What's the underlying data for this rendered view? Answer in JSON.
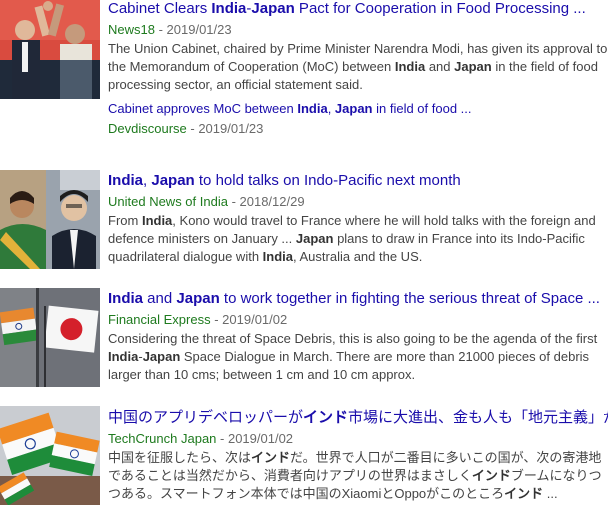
{
  "results": [
    {
      "title_parts": [
        {
          "t": "Cabinet Clears ",
          "b": false
        },
        {
          "t": "India",
          "b": true
        },
        {
          "t": "-",
          "b": false
        },
        {
          "t": "Japan",
          "b": true
        },
        {
          "t": " Pact for Cooperation in Food Processing ...",
          "b": false
        }
      ],
      "source": "News18",
      "date": "2019/01/23",
      "snippet_parts": [
        {
          "t": "The Union Cabinet, chaired by Prime Minister Narendra Modi, has given its approval to the Memorandum of Cooperation (MoC) between ",
          "b": false
        },
        {
          "t": "India",
          "b": true
        },
        {
          "t": " and ",
          "b": false
        },
        {
          "t": "Japan",
          "b": true
        },
        {
          "t": " in the field of food processing sector, an official statement said.",
          "b": false
        }
      ],
      "related": {
        "title_parts": [
          {
            "t": "Cabinet approves MoC between ",
            "b": false
          },
          {
            "t": "India",
            "b": true
          },
          {
            "t": ", ",
            "b": false
          },
          {
            "t": "Japan",
            "b": true
          },
          {
            "t": " in field of food ...",
            "b": false
          }
        ],
        "source": "Devdiscourse",
        "date": "2019/01/23"
      }
    },
    {
      "title_parts": [
        {
          "t": "India",
          "b": true
        },
        {
          "t": ", ",
          "b": false
        },
        {
          "t": "Japan",
          "b": true
        },
        {
          "t": " to hold talks on Indo-Pacific next month",
          "b": false
        }
      ],
      "source": "United News of India",
      "date": "2018/12/29",
      "snippet_parts": [
        {
          "t": "From ",
          "b": false
        },
        {
          "t": "India",
          "b": true
        },
        {
          "t": ", Kono would travel to France where he will hold talks with the foreign and defence ministers on January ... ",
          "b": false
        },
        {
          "t": "Japan",
          "b": true
        },
        {
          "t": " plans to draw in France into its Indo-Pacific quadrilateral dialogue with ",
          "b": false
        },
        {
          "t": "India",
          "b": true
        },
        {
          "t": ", Australia and the US.",
          "b": false
        }
      ]
    },
    {
      "title_parts": [
        {
          "t": "India",
          "b": true
        },
        {
          "t": " and ",
          "b": false
        },
        {
          "t": "Japan",
          "b": true
        },
        {
          "t": " to work together in fighting the serious threat of Space ...",
          "b": false
        }
      ],
      "source": "Financial Express",
      "date": "2019/01/02",
      "snippet_parts": [
        {
          "t": "Considering the threat of Space Debris, this is also going to be the agenda of the first ",
          "b": false
        },
        {
          "t": "India",
          "b": true
        },
        {
          "t": "-",
          "b": false
        },
        {
          "t": "Japan",
          "b": true
        },
        {
          "t": " Space Dialogue in March. There are more than 21000 pieces of debris larger than 10 cms; between 1 cm and 10 cm approx.",
          "b": false
        }
      ]
    },
    {
      "title_parts": [
        {
          "t": "中国のアプリデベロッパーが",
          "b": false
        },
        {
          "t": "インド",
          "b": true
        },
        {
          "t": "市場に大進出、金も人も「地元主義」が ...",
          "b": false
        }
      ],
      "source": "TechCrunch Japan",
      "date": "2019/01/02",
      "snippet_parts": [
        {
          "t": "中国を征服したら、次は",
          "b": false
        },
        {
          "t": "インド",
          "b": true
        },
        {
          "t": "だ。世界で人口が二番目に多いこの国が、次の寄港地であることは当然だから、消費者向けアプリの世界はまさしく",
          "b": false
        },
        {
          "t": "インド",
          "b": true
        },
        {
          "t": "ブームになりつつある。スマートフォン本体では中国のXiaomiとOppoがこのところ",
          "b": false
        },
        {
          "t": "インド",
          "b": true
        },
        {
          "t": " ...",
          "b": false
        }
      ]
    }
  ],
  "separator": " - ",
  "colors": {
    "link": "#1a0dab",
    "source": "#1e7a1e",
    "snippet": "#444444",
    "date": "#6a6a6a"
  }
}
